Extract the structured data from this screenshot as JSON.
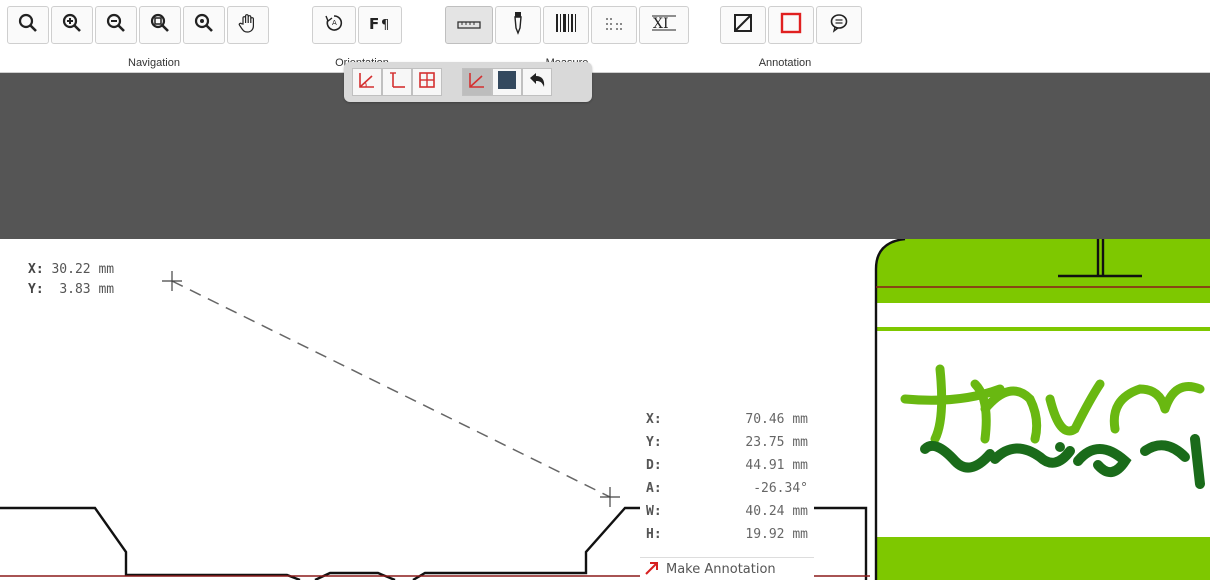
{
  "toolbar": {
    "groups": {
      "navigation": "Navigation",
      "orientation": "Orientation",
      "measure": "Measure",
      "annotation": "Annotation"
    },
    "icons": {
      "navigation": [
        "zoom-icon",
        "zoom-in-icon",
        "zoom-out-icon",
        "zoom-fit-icon",
        "zoom-actual-icon",
        "pan-hand-icon"
      ],
      "orientation": [
        "rotate-icon",
        "flip-icon"
      ],
      "measure": [
        "ruler-icon",
        "color-picker-icon",
        "barcode-icon",
        "dot-grid-icon",
        "text-measure-icon"
      ],
      "annotation": [
        "line-annotation-icon",
        "rectangle-annotation-icon",
        "comment-annotation-icon"
      ]
    }
  },
  "submenu": {
    "icons": [
      "angle-measure-icon",
      "perpendicular-measure-icon",
      "grid-measure-icon",
      "angle-mode-icon",
      "fill-square-icon",
      "undo-arrow-icon"
    ]
  },
  "start_point": {
    "x_label": "X:",
    "x_value": "30.22 mm",
    "y_label": "Y:",
    "y_value": "3.83 mm"
  },
  "readout": {
    "rows": [
      {
        "label": "X:",
        "value": "70.46 mm"
      },
      {
        "label": "Y:",
        "value": "23.75 mm"
      },
      {
        "label": "D:",
        "value": "44.91 mm"
      },
      {
        "label": "A:",
        "value": "-26.34°"
      },
      {
        "label": "W:",
        "value": "40.24 mm"
      },
      {
        "label": "H:",
        "value": "19.92 mm"
      }
    ],
    "make_annotation": "Make Annotation"
  },
  "colors": {
    "dark_band": "#555555",
    "label_green": "#7ec800",
    "dieline_red": "#8b1a1a",
    "script_light": "#69b811",
    "script_dark": "#1a6b1a"
  }
}
